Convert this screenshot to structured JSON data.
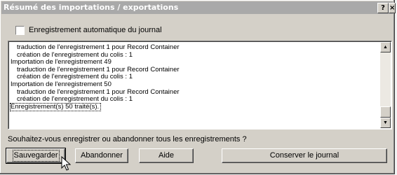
{
  "window": {
    "title": "Résumé des importations / exportations"
  },
  "title_buttons": {
    "help": "?",
    "close": "×"
  },
  "auto_save": {
    "label": "Enregistrement automatique du journal",
    "checked": false
  },
  "log": {
    "lines": [
      {
        "text": "traduction de l'enregistrement 1 pour Record Container",
        "indent": true
      },
      {
        "text": "création de l'enregistrement du colis : 1",
        "indent": true
      },
      {
        "text": "Importation de l'enregistrement 49",
        "indent": false
      },
      {
        "text": "traduction de l'enregistrement 1 pour Record Container",
        "indent": true
      },
      {
        "text": "création de l'enregistrement du colis : 1",
        "indent": true
      },
      {
        "text": "Importation de l'enregistrement 50",
        "indent": false
      },
      {
        "text": "traduction de l'enregistrement 1 pour Record Container",
        "indent": true
      },
      {
        "text": "création de l'enregistrement du colis : 1",
        "indent": true
      },
      {
        "text": "Enregistrement(s) 50 traité(s).",
        "indent": false
      }
    ]
  },
  "question": "Souhaitez-vous enregistrer ou abandonner tous les enregistrements ?",
  "buttons": {
    "save": "Sauvegarder",
    "abort": "Abandonner",
    "help": "Aide",
    "keep_log": "Conserver le journal"
  }
}
